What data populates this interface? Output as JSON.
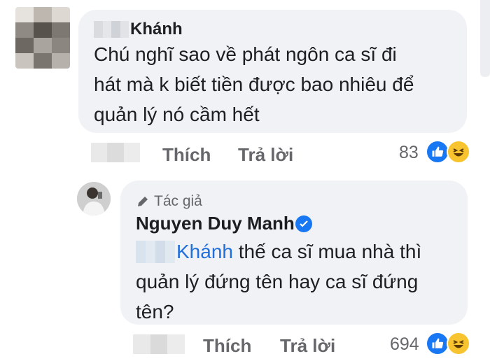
{
  "comment1": {
    "author_suffix": "Khánh",
    "text_lines": [
      "Chú nghĩ sao về phát ngôn ca sĩ đi",
      "hát mà k biết tiền được bao nhiêu để",
      "quản lý nó cầm hết"
    ],
    "like_label": "Thích",
    "reply_label": "Trả lời",
    "reaction_count": "83"
  },
  "reply": {
    "author_badge": "Tác giả",
    "author_name": "Nguyen Duy Manh",
    "mention": "Khánh",
    "text_first": " thế ca sĩ mua nhà thì",
    "text_lines": [
      "quản lý đứng tên hay ca sĩ đứng",
      "tên?"
    ],
    "like_label": "Thích",
    "reply_label": "Trả lời",
    "reaction_count": "694"
  },
  "colors": {
    "bubble": "#f0f2f5",
    "mention_blue": "#216fdb",
    "like_blue": "#1877f2",
    "haha_yellow": "#f7c32e",
    "secondary_text": "#65676b"
  },
  "icons": [
    "pencil-icon",
    "verified-badge-icon",
    "like-reaction-icon",
    "haha-reaction-icon",
    "avatar"
  ]
}
